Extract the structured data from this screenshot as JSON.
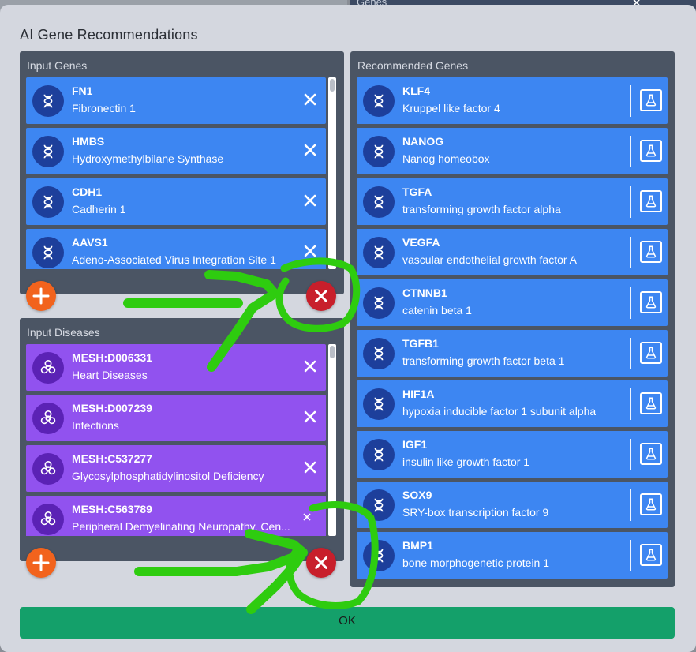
{
  "background_window": {
    "title": "Genes"
  },
  "dialog": {
    "title": "AI Gene Recommendations",
    "ok_label": "OK"
  },
  "input_genes": {
    "label": "Input Genes",
    "items": [
      {
        "symbol": "FN1",
        "name": "Fibronectin 1"
      },
      {
        "symbol": "HMBS",
        "name": "Hydroxymethylbilane Synthase"
      },
      {
        "symbol": "CDH1",
        "name": "Cadherin 1"
      },
      {
        "symbol": "AAVS1",
        "name": "Adeno-Associated Virus Integration Site 1"
      }
    ]
  },
  "input_diseases": {
    "label": "Input Diseases",
    "items": [
      {
        "id": "MESH:D006331",
        "name": "Heart Diseases"
      },
      {
        "id": "MESH:D007239",
        "name": "Infections"
      },
      {
        "id": "MESH:C537277",
        "name": "Glycosylphosphatidylinositol Deficiency"
      },
      {
        "id": "MESH:C563789",
        "name": "Peripheral Demyelinating Neuropathy, Cen..."
      }
    ]
  },
  "recommended_genes": {
    "label": "Recommended Genes",
    "items": [
      {
        "symbol": "KLF4",
        "name": "Kruppel like factor 4"
      },
      {
        "symbol": "NANOG",
        "name": "Nanog homeobox"
      },
      {
        "symbol": "TGFA",
        "name": "transforming growth factor alpha"
      },
      {
        "symbol": "VEGFA",
        "name": "vascular endothelial growth factor A"
      },
      {
        "symbol": "CTNNB1",
        "name": "catenin beta 1"
      },
      {
        "symbol": "TGFB1",
        "name": "transforming growth factor beta 1"
      },
      {
        "symbol": "HIF1A",
        "name": "hypoxia inducible factor 1 subunit alpha"
      },
      {
        "symbol": "IGF1",
        "name": "insulin like growth factor 1"
      },
      {
        "symbol": "SOX9",
        "name": "SRY-box transcription factor 9"
      },
      {
        "symbol": "BMP1",
        "name": "bone morphogenetic protein 1"
      }
    ]
  },
  "icons": {
    "gene": "dna-icon",
    "disease": "biohazard-icon",
    "remove": "close-icon",
    "test": "flask-icon",
    "add": "plus-icon",
    "clear": "x-circle-icon"
  },
  "colors": {
    "gene_card": "#3d86f2",
    "disease_card": "#9152ef",
    "add_button": "#f2631d",
    "clear_button": "#c81f2b",
    "ok_button": "#14a06a",
    "annotation": "#2ecc0f"
  }
}
